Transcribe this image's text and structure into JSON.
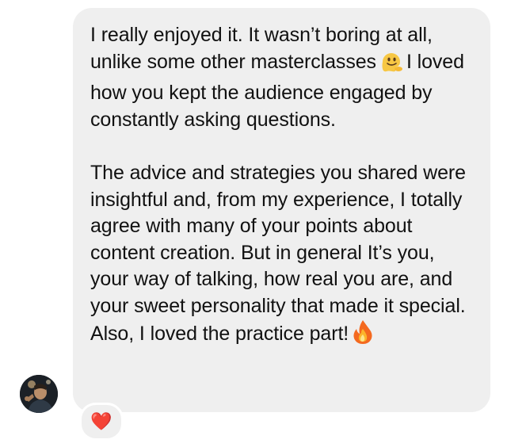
{
  "message": {
    "paragraph_1_before_emoji": "I really enjoyed it. It wasn’t boring at all, unlike some other masterclasses",
    "paragraph_1_after_emoji": "I loved how you kept the audience engaged by constantly asking questions.",
    "paragraph_2_before_emoji": "The advice and strategies you shared were insightful and, from my experience, I totally agree with many of your points about content creation. But in general It’s you, your way of talking, how real you are, and your sweet personality that made it special. Also, I loved the practice part!",
    "emoji_1": "melting-face-emoji",
    "emoji_2": "fire-emoji"
  },
  "reaction": {
    "emoji": "❤️"
  },
  "colors": {
    "bubble_bg": "#efefef",
    "text": "#111111",
    "heart": "#e0245e"
  }
}
